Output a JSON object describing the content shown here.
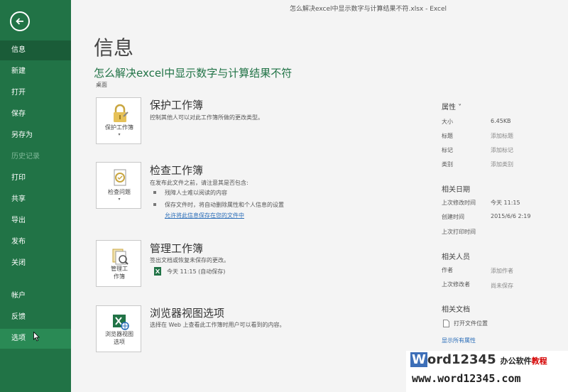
{
  "titlebar": {
    "title": "怎么解决excel中显示数字与计算结果不符.xlsx  -  Excel"
  },
  "sidebar": {
    "items": [
      {
        "label": "信息"
      },
      {
        "label": "新建"
      },
      {
        "label": "打开"
      },
      {
        "label": "保存"
      },
      {
        "label": "另存为"
      },
      {
        "label": "历史记录"
      },
      {
        "label": "打印"
      },
      {
        "label": "共享"
      },
      {
        "label": "导出"
      },
      {
        "label": "发布"
      },
      {
        "label": "关闭"
      },
      {
        "label": "帐户"
      },
      {
        "label": "反馈"
      },
      {
        "label": "选项"
      }
    ]
  },
  "main": {
    "page_title": "信息",
    "doc_title": "怎么解决excel中显示数字与计算结果不符",
    "doc_location": "桌面",
    "protect": {
      "tile_line1": "保护工作簿",
      "heading": "保护工作簿",
      "desc": "控制其他人可以对此工作簿所做的更改类型。"
    },
    "inspect": {
      "tile_line1": "检查问题",
      "heading": "检查工作簿",
      "desc": "在发布此文件之前，请注意其是否包含:",
      "bullets": [
        "残障人士难以阅读的内容",
        "保存文件时，将自动删除属性和个人信息的设置"
      ],
      "link": "允许将此信息保存在您的文件中"
    },
    "manage": {
      "tile_line1": "管理工",
      "tile_line2": "作簿",
      "heading": "管理工作簿",
      "desc": "签出文档或恢复未保存的更改。",
      "version": "今天 11:15 (自动保存)"
    },
    "browser": {
      "tile_line1": "浏览器视图",
      "tile_line2": "选项",
      "heading": "浏览器视图选项",
      "desc": "选择在 Web 上查看此工作簿时用户可以看到的内容。"
    }
  },
  "properties": {
    "heading": "属性 ˅",
    "rows": [
      {
        "key": "大小",
        "value": "6.45KB"
      },
      {
        "key": "标题",
        "value": "添加标题"
      },
      {
        "key": "标记",
        "value": "添加标记"
      },
      {
        "key": "类别",
        "value": "添加类别"
      }
    ],
    "dates_heading": "相关日期",
    "dates": [
      {
        "key": "上次修改时间",
        "value": "今天 11:15"
      },
      {
        "key": "创建时间",
        "value": "2015/6/6 2:19"
      },
      {
        "key": "上次打印时间",
        "value": ""
      }
    ],
    "people_heading": "相关人员",
    "people": [
      {
        "key": "作者",
        "value": "添加作者"
      },
      {
        "key": "上次修改者",
        "value": "尚未保存"
      }
    ],
    "docs_heading": "相关文档",
    "open_location": "打开文件位置",
    "show_all": "显示所有属性"
  },
  "watermark": {
    "brand_w": "W",
    "brand_rest": "ord12345",
    "tag_black": "办公软件",
    "tag_red": "教程",
    "url": "www.word12345.com"
  }
}
